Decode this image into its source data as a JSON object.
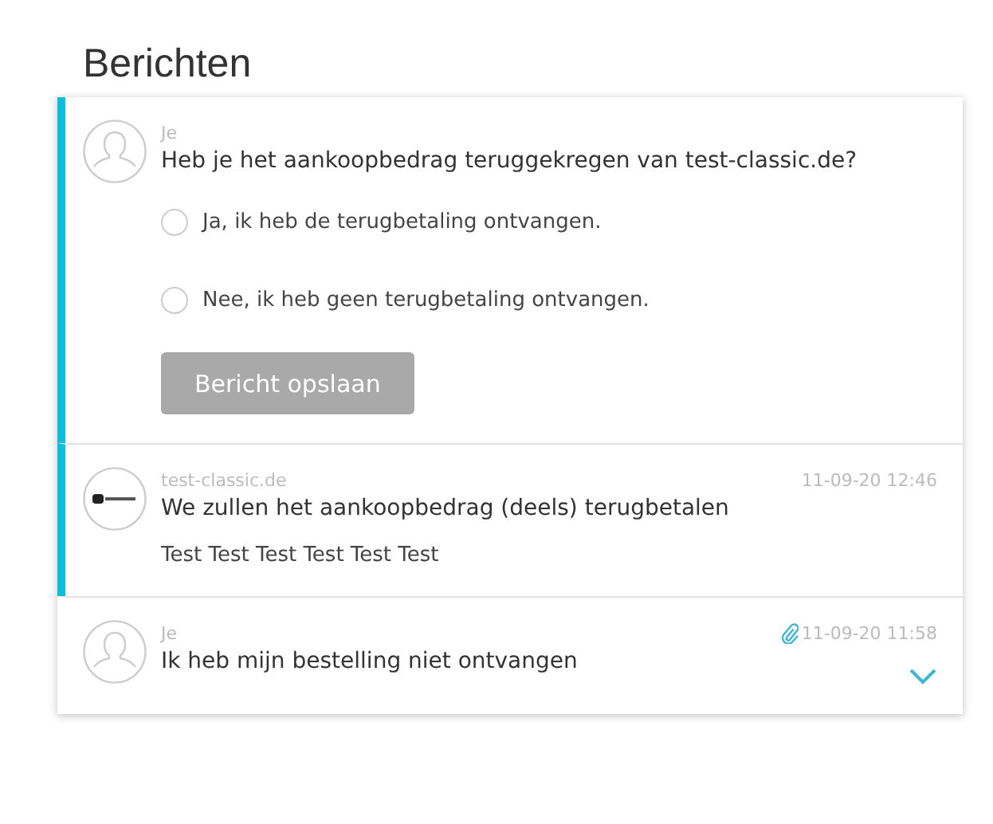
{
  "title": "Berichten",
  "messages": [
    {
      "kind": "question",
      "sender": "Je",
      "avatar": {
        "kind": "person"
      },
      "highlighted": true,
      "text": "Heb je het aankoopbedrag teruggekregen van test-classic.de?",
      "options": [
        {
          "label": "Ja, ik heb de terugbetaling ontvangen.",
          "selected": false
        },
        {
          "label": "Nee, ik heb geen terugbetaling ontvangen.",
          "selected": false
        }
      ],
      "button": {
        "label": "Bericht opslaan",
        "disabled": true
      }
    },
    {
      "kind": "message",
      "sender": "test-classic.de",
      "avatar": {
        "kind": "logo"
      },
      "highlighted": true,
      "time": "11-09-20 12:46",
      "attachment": false,
      "subject": "We zullen het aankoopbedrag (deels) terugbetalen",
      "body": "Test Test Test Test Test Test",
      "expanded": true
    },
    {
      "kind": "message",
      "sender": "Je",
      "avatar": {
        "kind": "person"
      },
      "highlighted": false,
      "time": "11-09-20 11:58",
      "attachment": true,
      "subject": "Ik heb mijn bestelling niet ontvangen",
      "expanded": false
    }
  ]
}
